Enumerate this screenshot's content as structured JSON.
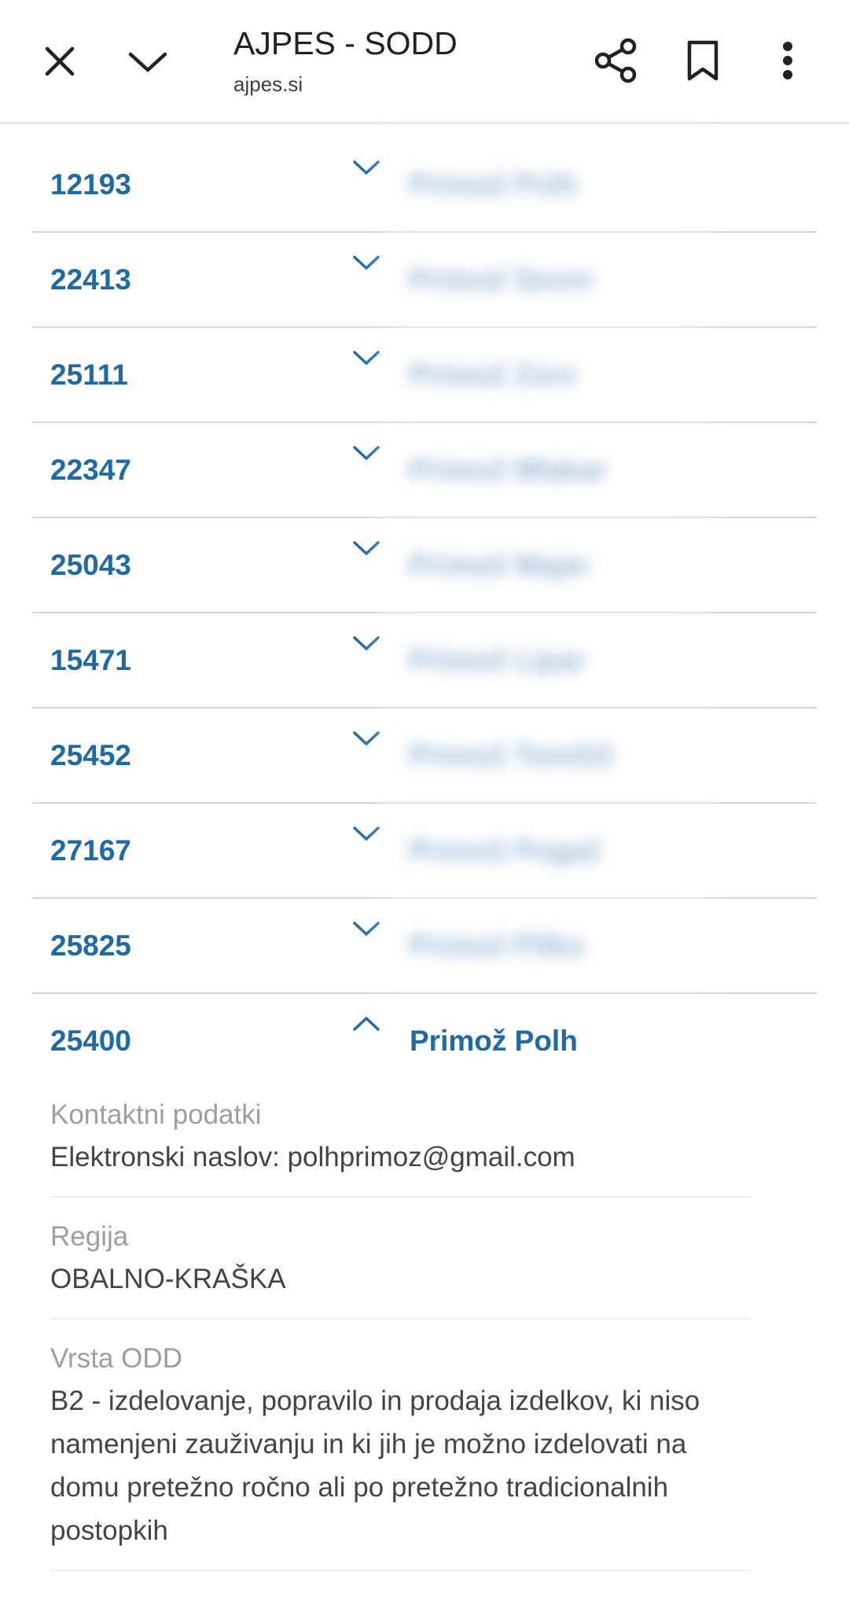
{
  "appbar": {
    "title": "AJPES - SODD",
    "subtitle": "ajpes.si",
    "icons": [
      "close-icon",
      "chevron-down-icon",
      "share-icon",
      "bookmark-icon",
      "more-vert-icon"
    ]
  },
  "list": {
    "rows": [
      {
        "id": "12193",
        "name": "Primož Polh"
      },
      {
        "id": "22413",
        "name": "Primož Sever"
      },
      {
        "id": "25111",
        "name": "Primož Zorc"
      },
      {
        "id": "22347",
        "name": "Primož Mlakar"
      },
      {
        "id": "25043",
        "name": "Primož Majer"
      },
      {
        "id": "15471",
        "name": "Primož Lipar"
      },
      {
        "id": "25452",
        "name": "Primož Tomšič"
      },
      {
        "id": "27167",
        "name": "Primož Pogač"
      },
      {
        "id": "25825",
        "name": "Primož Pilko"
      }
    ],
    "expanded": {
      "id": "25400",
      "name": "Primož Polh",
      "details": [
        {
          "label": "Kontaktni podatki",
          "value": "Elektronski naslov: polhprimoz@gmail.com"
        },
        {
          "label": "Regija",
          "value": "OBALNO-KRAŠKA"
        },
        {
          "label": "Vrsta ODD",
          "value": "B2 - izdelovanje, popravilo in prodaja izdelkov, ki niso namenjeni zauživanju in ki jih je možno izdelovati na domu pretežno ročno ali po pretežno tradicionalnih postopkih"
        }
      ]
    }
  },
  "colors": {
    "accent": "#1f6aa3",
    "label": "#9e9e9e",
    "text": "#444444",
    "divider": "#d4d4d4"
  }
}
